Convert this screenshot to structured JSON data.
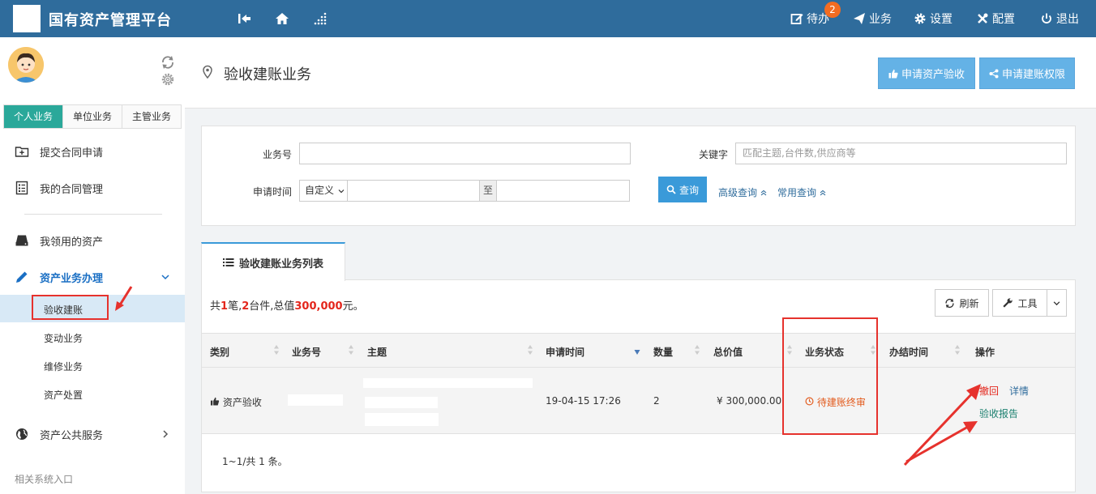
{
  "header": {
    "app_title": "国有资产管理平台",
    "nav": [
      {
        "label": "待办",
        "icon": "edit-icon"
      },
      {
        "label": "业务",
        "icon": "send-icon"
      },
      {
        "label": "设置",
        "icon": "gear-icon"
      },
      {
        "label": "配置",
        "icon": "tools-icon"
      },
      {
        "label": "退出",
        "icon": "power-icon"
      }
    ],
    "todo_badge": "2"
  },
  "sidebar": {
    "tabs": [
      "个人业务",
      "单位业务",
      "主管业务"
    ],
    "items": [
      {
        "label": "提交合同申请",
        "icon": "folder-plus-icon"
      },
      {
        "label": "我的合同管理",
        "icon": "list-doc-icon"
      },
      {
        "label": "我领用的资产",
        "icon": "drive-icon"
      },
      {
        "label": "资产业务办理",
        "icon": "pencil-icon"
      },
      {
        "label": "资产公共服务",
        "icon": "globe-icon"
      }
    ],
    "sub_items": [
      "验收建账",
      "变动业务",
      "维修业务",
      "资产处置"
    ],
    "footer": "相关系统入口"
  },
  "page": {
    "title": "验收建账业务",
    "btn_apply_acceptance": "申请资产验收",
    "btn_apply_permission": "申请建账权限"
  },
  "search": {
    "biz_no_label": "业务号",
    "keyword_label": "关键字",
    "keyword_placeholder": "匹配主题,台件数,供应商等",
    "time_label": "申请时间",
    "time_select": "自定义",
    "to_label": "至",
    "query_btn": "查询",
    "advanced_link": "高级查询",
    "common_link": "常用查询"
  },
  "list": {
    "tab_label": "验收建账业务列表",
    "summary_prefix": "共",
    "summary_count": "1",
    "summary_mid1": "笔,",
    "summary_items": "2",
    "summary_mid2": "台件,总值",
    "summary_value": "300,000",
    "summary_suffix": "元。",
    "refresh_btn": "刷新",
    "tools_btn": "工具",
    "columns": [
      "类别",
      "业务号",
      "主题",
      "申请时间",
      "数量",
      "总价值",
      "业务状态",
      "办结时间",
      "操作"
    ],
    "rows": [
      {
        "category": "资产验收",
        "apply_time": "19-04-15 17:26",
        "quantity": "2",
        "total_value": "¥ 300,000.00",
        "status": "待建账终审",
        "ops": [
          "撤回",
          "详情",
          "验收报告"
        ]
      }
    ],
    "pager": "1~1/共 1 条。"
  }
}
